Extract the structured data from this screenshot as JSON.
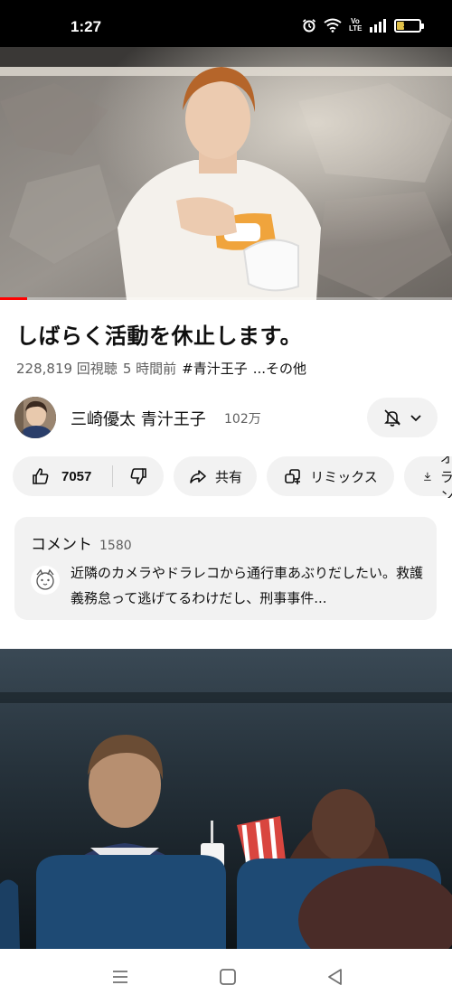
{
  "status_bar": {
    "time": "1:27",
    "network_label": "Vo\nLTE",
    "battery": "38",
    "battery_level": 0.38,
    "icons": [
      "alarm-icon",
      "wifi-icon",
      "volte-icon",
      "signal-icon",
      "battery-icon"
    ]
  },
  "video": {
    "progress_fraction": 0.06,
    "title": "しばらく活動を休止します。",
    "views": "228,819 回視聴",
    "posted": "5 時間前",
    "hashtag": "#青汁王子",
    "more": "...その他"
  },
  "channel": {
    "name": "三崎優太 青汁王子",
    "subscribers": "102万",
    "bell_icon": "bell-off-icon",
    "chevron_icon": "chevron-down-icon"
  },
  "actions": {
    "like_count": "7057",
    "share_label": "共有",
    "remix_label": "リミックス",
    "download_label": "オフライン"
  },
  "comments": {
    "label": "コメント",
    "count": "1580",
    "top_comment": "近隣のカメラやドラレコから通行車あぶりだしたい。救護義務怠って逃げてるわけだし、刑事事件..."
  },
  "nav": {
    "icons": [
      "menu-icon",
      "home-square-icon",
      "back-triangle-icon"
    ]
  },
  "colors": {
    "accent_red": "#ff0000",
    "pill_bg": "#f2f2f2",
    "secondary_text": "#606060"
  }
}
